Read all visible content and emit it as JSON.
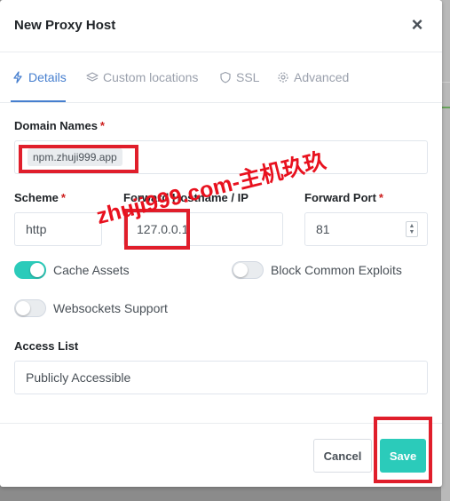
{
  "modal": {
    "title": "New Proxy Host",
    "close_glyph": "×"
  },
  "tabs": [
    {
      "label": "Details",
      "icon": "bolt-icon"
    },
    {
      "label": "Custom locations",
      "icon": "layers-icon"
    },
    {
      "label": "SSL",
      "icon": "shield-icon"
    },
    {
      "label": "Advanced",
      "icon": "gear-icon"
    }
  ],
  "form": {
    "domain_names_label": "Domain Names",
    "domain_names_value": "npm.zhuji999.app",
    "scheme_label": "Scheme",
    "scheme_value": "http",
    "forward_host_label": "Forward Hostname / IP",
    "forward_host_value": "127.0.0.1",
    "forward_port_label": "Forward Port",
    "forward_port_value": "81",
    "required_mark": "*",
    "cache_assets_label": "Cache Assets",
    "cache_assets_on": true,
    "block_exploits_label": "Block Common Exploits",
    "block_exploits_on": false,
    "websockets_label": "Websockets Support",
    "websockets_on": false,
    "access_list_label": "Access List",
    "access_list_value": "Publicly Accessible"
  },
  "footer": {
    "cancel_label": "Cancel",
    "save_label": "Save"
  },
  "watermark": "zhuji999.com-主机玖玖",
  "colors": {
    "accent": "#467fcf",
    "toggle_on": "#2bcbba",
    "required": "#cd201f",
    "annotation_red": "#e01e2b"
  }
}
